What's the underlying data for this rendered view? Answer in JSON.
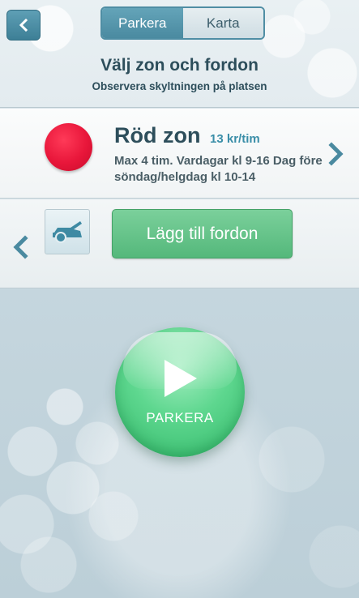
{
  "header": {
    "back_icon": "chevron-left-icon",
    "segments": [
      {
        "label": "Parkera",
        "active": true
      },
      {
        "label": "Karta",
        "active": false
      }
    ],
    "title": "Välj zon och fordon",
    "subtitle": "Observera skyltningen på platsen"
  },
  "zone": {
    "color": "#e8163a",
    "name": "Röd zon",
    "price": "13 kr/tim",
    "description": "Max 4 tim. Vardagar kl 9-16 Dag före söndag/helgdag kl 10-14",
    "next_icon": "chevron-right-icon"
  },
  "vehicle": {
    "prev_icon": "chevron-left-icon",
    "icon": "car-icon",
    "add_label": "Lägg till fordon"
  },
  "park": {
    "icon": "play-icon",
    "label": "PARKERA"
  },
  "colors": {
    "accent": "#4a8aa0",
    "primary_text": "#2d4e5b",
    "green": "#54b87b"
  }
}
